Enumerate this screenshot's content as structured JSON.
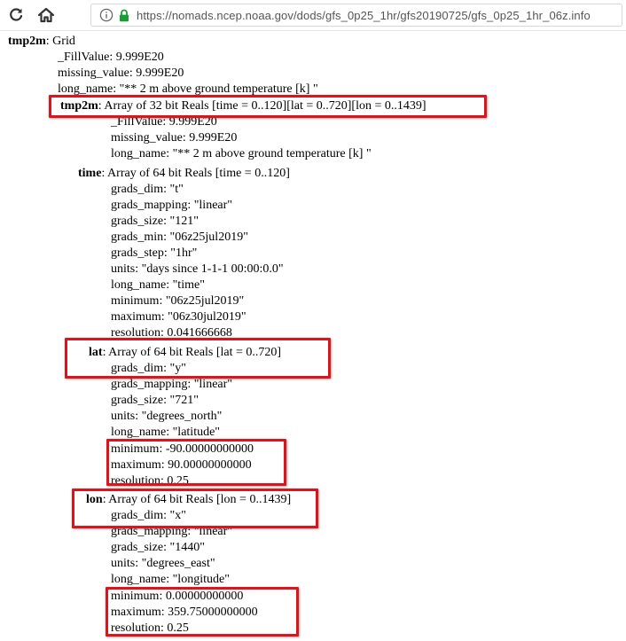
{
  "browser": {
    "url": "https://nomads.ncep.noaa.gov/dods/gfs_0p25_1hr/gfs20190725/gfs_0p25_1hr_06z.info"
  },
  "colors": {
    "highlight": "#e2121b",
    "lock": "#1a9c37"
  },
  "icons": [
    "reload-icon",
    "home-icon",
    "info-icon",
    "lock-icon"
  ],
  "doc": {
    "grid_name": "tmp2m",
    "grid_type": ": Grid",
    "grid_attrs": [
      "_FillValue: 9.999E20",
      "missing_value: 9.999E20",
      "long_name: \"** 2 m above ground temperature [k] \""
    ],
    "vars": [
      {
        "name": "tmp2m",
        "decl": ": Array of 32 bit Reals [time = 0..120][lat = 0..720][lon = 0..1439]",
        "attrs": [
          "_FillValue: 9.999E20",
          "missing_value: 9.999E20",
          "long_name: \"** 2 m above ground temperature [k] \""
        ]
      },
      {
        "name": "time",
        "decl": ": Array of 64 bit Reals [time = 0..120]",
        "attrs": [
          "grads_dim: \"t\"",
          "grads_mapping: \"linear\"",
          "grads_size: \"121\"",
          "grads_min: \"06z25jul2019\"",
          "grads_step: \"1hr\"",
          "units: \"days since 1-1-1 00:00:0.0\"",
          "long_name: \"time\"",
          "minimum: \"06z25jul2019\"",
          "maximum: \"06z30jul2019\"",
          "resolution: 0.041666668"
        ]
      },
      {
        "name": "lat",
        "decl": ": Array of 64 bit Reals [lat = 0..720]",
        "attrs": [
          "grads_dim: \"y\"",
          "grads_mapping: \"linear\"",
          "grads_size: \"721\"",
          "units: \"degrees_north\"",
          "long_name: \"latitude\"",
          "minimum: -90.00000000000",
          "maximum: 90.00000000000",
          "resolution: 0.25"
        ]
      },
      {
        "name": "lon",
        "decl": ": Array of 64 bit Reals [lon = 0..1439]",
        "attrs": [
          "grads_dim: \"x\"",
          "grads_mapping: \"linear\"",
          "grads_size: \"1440\"",
          "units: \"degrees_east\"",
          "long_name: \"longitude\"",
          "minimum: 0.00000000000",
          "maximum: 359.75000000000",
          "resolution: 0.25"
        ]
      }
    ]
  }
}
